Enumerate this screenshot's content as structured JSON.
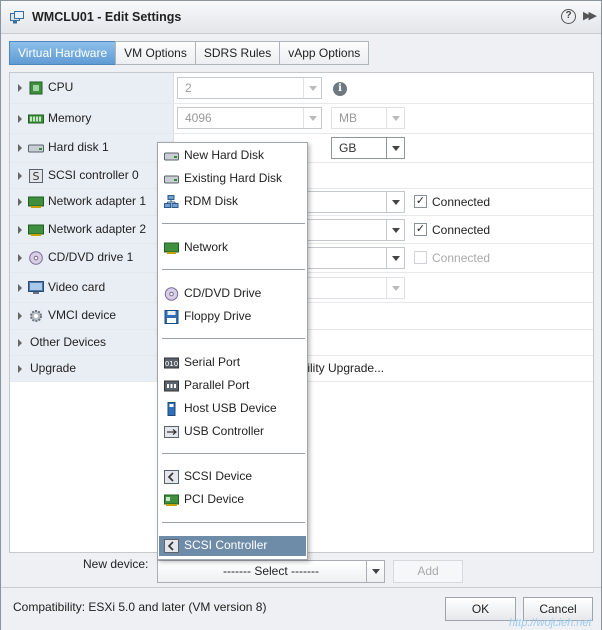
{
  "window": {
    "title": "WMCLU01 - Edit Settings",
    "help_label": "?",
    "expand_label": "▶▶"
  },
  "tabs": [
    {
      "label": "Virtual Hardware",
      "active": true
    },
    {
      "label": "VM Options",
      "active": false
    },
    {
      "label": "SDRS Rules",
      "active": false
    },
    {
      "label": "vApp Options",
      "active": false
    }
  ],
  "hardware": {
    "cpu": {
      "label": "CPU",
      "value": "2",
      "info": "i"
    },
    "memory": {
      "label": "Memory",
      "value": "4096",
      "unit": "MB"
    },
    "hard_disk": {
      "label": "Hard disk 1",
      "unit": "GB"
    },
    "scsi_controller": {
      "label": "SCSI controller 0"
    },
    "network_adapter_1": {
      "label": "Network adapter 1",
      "connected_label": "Connected",
      "connected": true
    },
    "network_adapter_2": {
      "label": "Network adapter 2",
      "connected_label": "Connected",
      "connected": true
    },
    "cd_dvd": {
      "label": "CD/DVD drive 1",
      "connected_label": "Connected",
      "connected": false
    },
    "video_card": {
      "label": "Video card"
    },
    "vmci": {
      "label": "VMCI device"
    },
    "other_devices": {
      "label": "Other Devices"
    },
    "upgrade": {
      "label": "Upgrade",
      "value_partial": "atibility Upgrade..."
    }
  },
  "menu": {
    "items": [
      {
        "label": "New Hard Disk",
        "icon": "hard-disk-icon"
      },
      {
        "label": "Existing Hard Disk",
        "icon": "hard-disk-icon"
      },
      {
        "label": "RDM Disk",
        "icon": "rdm-disk-icon"
      },
      {
        "label": "Network",
        "icon": "network-icon"
      },
      {
        "label": "CD/DVD Drive",
        "icon": "cd-dvd-icon"
      },
      {
        "label": "Floppy Drive",
        "icon": "floppy-icon"
      },
      {
        "label": "Serial Port",
        "icon": "serial-port-icon"
      },
      {
        "label": "Parallel Port",
        "icon": "parallel-port-icon"
      },
      {
        "label": "Host USB Device",
        "icon": "usb-device-icon"
      },
      {
        "label": "USB Controller",
        "icon": "usb-controller-icon"
      },
      {
        "label": "SCSI Device",
        "icon": "scsi-device-icon"
      },
      {
        "label": "PCI Device",
        "icon": "pci-device-icon"
      },
      {
        "label": "SCSI Controller",
        "icon": "scsi-controller-icon",
        "selected": true
      }
    ]
  },
  "new_device": {
    "label": "New device:",
    "select_value": "------- Select -------",
    "add_label": "Add"
  },
  "footer": {
    "compatibility": "Compatibility: ESXi 5.0 and later (VM version 8)",
    "ok_label": "OK",
    "cancel_label": "Cancel"
  },
  "watermark": "http://wojcieh.net"
}
